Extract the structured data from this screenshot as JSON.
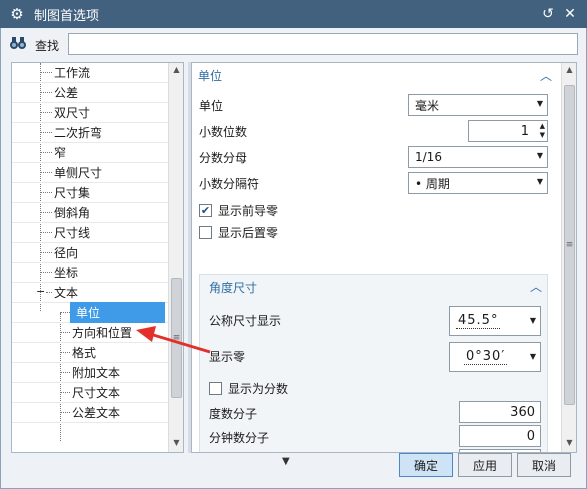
{
  "window": {
    "title": "制图首选项",
    "gear_icon": "gear-icon",
    "reset_icon": "reset-icon",
    "close_icon": "close-icon"
  },
  "search": {
    "label": "查找",
    "value": "",
    "icon": "binoculars-icon"
  },
  "tree": {
    "items": [
      {
        "label": "工作流"
      },
      {
        "label": "公差"
      },
      {
        "label": "双尺寸"
      },
      {
        "label": "二次折弯"
      },
      {
        "label": "窄"
      },
      {
        "label": "单侧尺寸"
      },
      {
        "label": "尺寸集"
      },
      {
        "label": "倒斜角"
      },
      {
        "label": "尺寸线"
      },
      {
        "label": "径向"
      },
      {
        "label": "坐标"
      },
      {
        "label": "文本",
        "expanded": true
      },
      {
        "label": "单位",
        "selected": true
      },
      {
        "label": "方向和位置"
      },
      {
        "label": "格式"
      },
      {
        "label": "附加文本"
      },
      {
        "label": "尺寸文本"
      },
      {
        "label": "公差文本"
      }
    ],
    "collapse_marker": "−"
  },
  "panel": {
    "unit_section": {
      "title": "单位",
      "unit_label": "单位",
      "unit_value": "毫米",
      "decimal_places_label": "小数位数",
      "decimal_places_value": "1",
      "fraction_denominator_label": "分数分母",
      "fraction_denominator_value": "1/16",
      "decimal_separator_label": "小数分隔符",
      "decimal_separator_value": "•  周期",
      "show_leading_zeros_label": "显示前导零",
      "show_leading_zeros_checked": true,
      "show_trailing_zeros_label": "显示后置零",
      "show_trailing_zeros_checked": false
    },
    "angle_section": {
      "title": "角度尺寸",
      "nominal_display_label": "公称尺寸显示",
      "nominal_display_value": "45.5°",
      "show_zero_label": "显示零",
      "show_zero_value": "0°30′",
      "show_as_fraction_label": "显示为分数",
      "show_as_fraction_checked": false,
      "degree_numerator_label": "度数分子",
      "degree_numerator_value": "360",
      "minute_numerator_label": "分钟数分子",
      "minute_numerator_value": "0"
    }
  },
  "buttons": {
    "ok": "确定",
    "apply": "应用",
    "cancel": "取消"
  },
  "annotation_arrow_color": "#e3302a",
  "colors": {
    "titlebar": "#41617f",
    "selection": "#3f9be8",
    "section_title": "#2f6ea3"
  }
}
